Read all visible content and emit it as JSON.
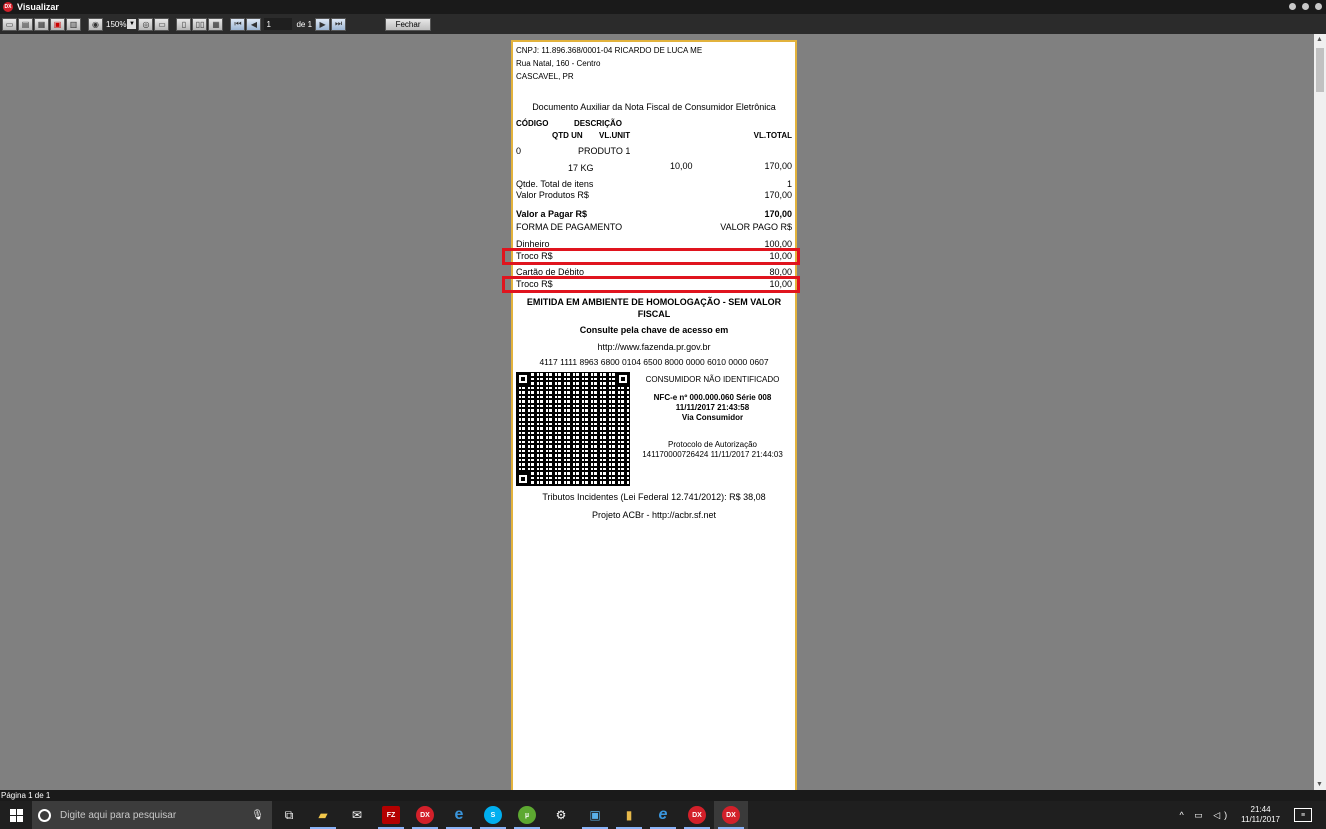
{
  "window": {
    "title": "Visualizar",
    "logo_text": "DX"
  },
  "toolbar": {
    "zoom": "150%",
    "page_current": "1",
    "page_of": "de 1",
    "close_label": "Fechar"
  },
  "receipt": {
    "header": {
      "line1": "CNPJ: 11.896.368/0001-04 RICARDO DE LUCA ME",
      "line2": "Rua Natal, 160 - Centro",
      "line3": "CASCAVEL, PR"
    },
    "doc_title": "Documento Auxiliar da Nota Fiscal de Consumidor Eletrônica",
    "cols": {
      "code": "CÓDIGO",
      "desc": "DESCRIÇÃO",
      "qtd_un": "QTD UN",
      "vl_unit": "VL.UNIT",
      "vl_total": "VL.TOTAL"
    },
    "item": {
      "code": "0",
      "desc": "PRODUTO 1",
      "qty": "17 KG",
      "unit": "10,00",
      "total": "170,00"
    },
    "totals": {
      "qtd_label": "Qtde. Total de itens",
      "qtd_value": "1",
      "produtos_label": "Valor Produtos R$",
      "produtos_value": "170,00",
      "pagar_label": "Valor a Pagar R$",
      "pagar_value": "170,00"
    },
    "payment": {
      "forma_label": "FORMA DE PAGAMENTO",
      "valor_label": "VALOR PAGO R$",
      "dinheiro_label": "Dinheiro",
      "dinheiro_value": "100,00",
      "troco1_label": "Troco R$",
      "troco1_value": "10,00",
      "cartao_label": "Cartão de Débito",
      "cartao_value": "80,00",
      "troco2_label": "Troco R$",
      "troco2_value": "10,00"
    },
    "homolog_line1": "EMITIDA EM AMBIENTE DE HOMOLOGAÇÃO - SEM VALOR",
    "homolog_line2": "FISCAL",
    "consulte": "Consulte pela chave de acesso em",
    "url": "http://www.fazenda.pr.gov.br",
    "chave": "4117 1111 8963 6800 0104 6500 8000 0000 6010 0000 0607",
    "consumidor": "CONSUMIDOR NÃO IDENTIFICADO",
    "nfce_line1": "NFC-e nº 000.000.060   Série 008",
    "nfce_line2": "11/11/2017 21:43:58",
    "nfce_line3": "Via Consumidor",
    "protocolo_label": "Protocolo de Autorização",
    "protocolo_value": "141170000726424 11/11/2017 21:44:03",
    "tributos": "Tributos Incidentes (Lei Federal 12.741/2012): R$ 38,08",
    "projeto": "Projeto ACBr - http://acbr.sf.net"
  },
  "status": {
    "page": "Página 1 de 1"
  },
  "taskbar": {
    "search_placeholder": "Digite aqui para pesquisar",
    "time": "21:44",
    "date": "11/11/2017"
  }
}
